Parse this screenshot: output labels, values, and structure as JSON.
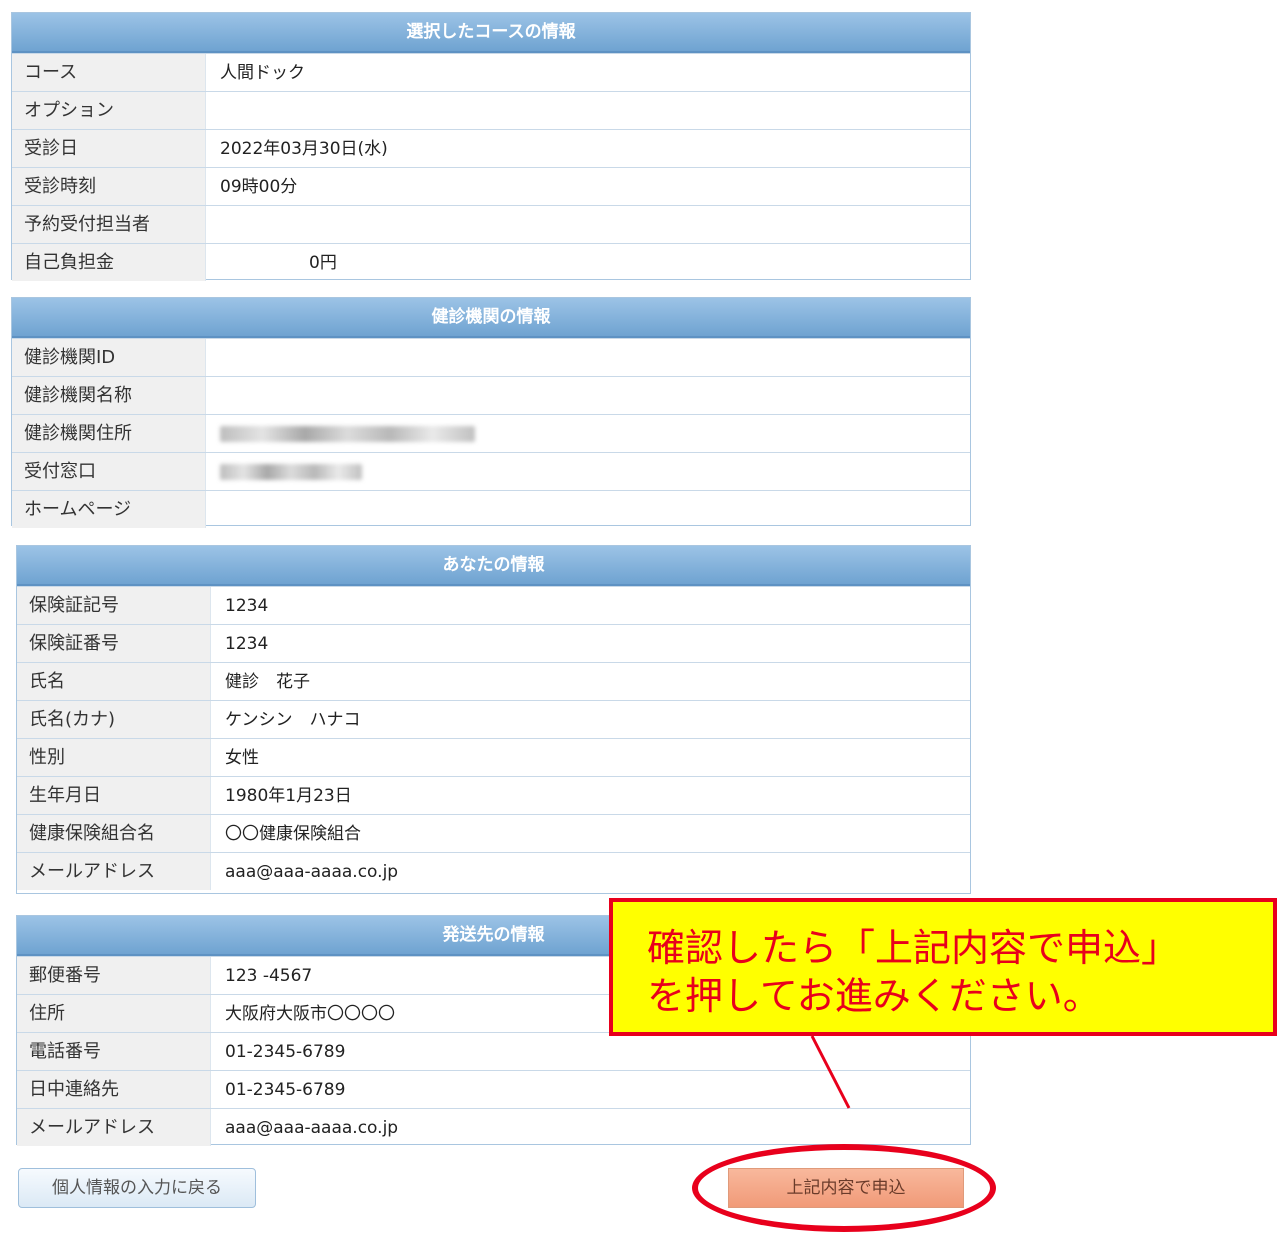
{
  "course": {
    "title": "選択したコースの情報",
    "rows": [
      {
        "label": "コース",
        "value": "人間ドック"
      },
      {
        "label": "オプション",
        "value": ""
      },
      {
        "label": "受診日",
        "value": "2022年03月30日(水)"
      },
      {
        "label": "受診時刻",
        "value": "09時00分"
      },
      {
        "label": "予約受付担当者",
        "value": ""
      },
      {
        "label": "自己負担金",
        "value": "0円"
      }
    ]
  },
  "institution": {
    "title": "健診機関の情報",
    "rows": [
      {
        "label": "健診機関ID",
        "value": ""
      },
      {
        "label": "健診機関名称",
        "value": ""
      },
      {
        "label": "健診機関住所",
        "value": ""
      },
      {
        "label": "受付窓口",
        "value": ""
      },
      {
        "label": "ホームページ",
        "value": ""
      }
    ]
  },
  "you": {
    "title": "あなたの情報",
    "rows": [
      {
        "label": "保険証記号",
        "value": "1234"
      },
      {
        "label": "保険証番号",
        "value": "1234"
      },
      {
        "label": "氏名",
        "value": "健診　花子"
      },
      {
        "label": "氏名(カナ)",
        "value": "ケンシン　ハナコ"
      },
      {
        "label": "性別",
        "value": "女性"
      },
      {
        "label": "生年月日",
        "value": "1980年1月23日"
      },
      {
        "label": "健康保険組合名",
        "value": "〇〇健康保険組合"
      },
      {
        "label": "メールアドレス",
        "value": "aaa@aaa-aaaa.co.jp"
      }
    ]
  },
  "shipping": {
    "title": "発送先の情報",
    "rows": [
      {
        "label": "郵便番号",
        "value": "123 -4567"
      },
      {
        "label": "住所",
        "value": "大阪府大阪市〇〇〇〇"
      },
      {
        "label": "電話番号",
        "value": "01-2345-6789"
      },
      {
        "label": "日中連絡先",
        "value": "01-2345-6789"
      },
      {
        "label": "メールアドレス",
        "value": "aaa@aaa-aaaa.co.jp"
      }
    ]
  },
  "buttons": {
    "back": "個人情報の入力に戻る",
    "apply": "上記内容で申込"
  },
  "callout": {
    "line1": "確認したら「上記内容で申込」",
    "line2": "を押してお進みください。",
    "color": "#e8001c",
    "background": "#ffff00"
  }
}
